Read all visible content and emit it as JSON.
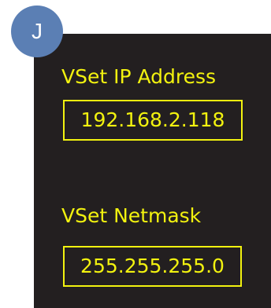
{
  "badge": {
    "letter": "J"
  },
  "fields": {
    "ip": {
      "label": "VSet IP Address",
      "value": "192.168.2.118"
    },
    "netmask": {
      "label": "VSet Netmask",
      "value": "255.255.255.0"
    }
  },
  "colors": {
    "screen_background": "#231f20",
    "text": "#f2f20f",
    "badge": "#5b7fb4"
  }
}
